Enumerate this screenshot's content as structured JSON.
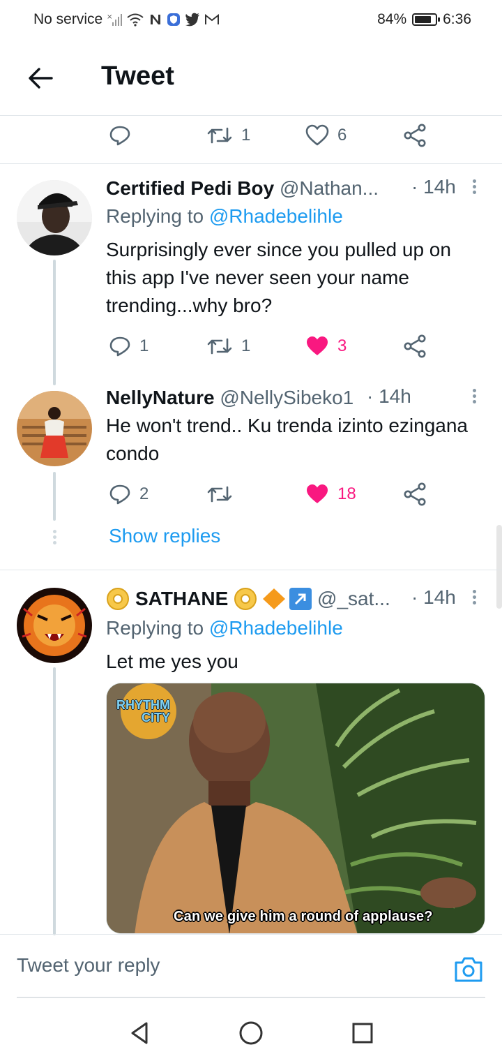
{
  "status_bar": {
    "carrier": "No service",
    "battery": "84%",
    "battery_level": 0.84,
    "time": "6:36"
  },
  "header": {
    "title": "Tweet"
  },
  "top_actions": {
    "reply_count": "",
    "retweet_count": "1",
    "like_count": "6"
  },
  "tweets": [
    {
      "name": "Certified Pedi Boy",
      "handle": "@Nathan...",
      "time": "· 14h",
      "replying_label": "Replying to",
      "replying_to": "@Rhadebelihle",
      "text": "Surprisingly ever since you pulled up on this app I've never seen your name trending...why bro?",
      "reply_count": "1",
      "retweet_count": "1",
      "like_count": "3",
      "liked": true
    },
    {
      "name": "NellyNature",
      "handle": "@NellySibeko1",
      "time": "· 14h",
      "text": "He won't trend.. Ku trenda izinto ezingana condo",
      "reply_count": "2",
      "retweet_count": "",
      "like_count": "18",
      "liked": true,
      "show_replies": "Show replies"
    },
    {
      "name": "SATHANE",
      "handle": "@_sat...",
      "time": "· 14h",
      "replying_label": "Replying to",
      "replying_to": "@Rhadebelihle",
      "text": "Let me yes you",
      "media_logo_line1": "RHYTHM",
      "media_logo_line2": "CITY",
      "media_caption": "Can we give him a round of applause?"
    }
  ],
  "composer": {
    "placeholder": "Tweet your reply"
  },
  "colors": {
    "accent": "#1d9bf0",
    "like": "#f91880",
    "muted": "#536471",
    "divider": "#e1e6ea"
  }
}
